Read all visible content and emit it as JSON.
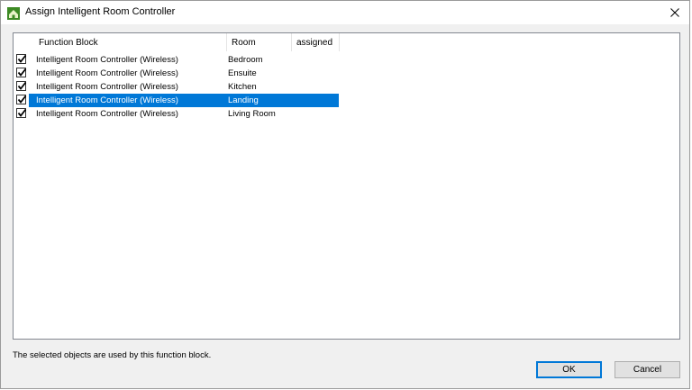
{
  "window": {
    "title": "Assign Intelligent Room Controller",
    "icon": "app-logo-icon"
  },
  "table": {
    "columns": [
      "Function Block",
      "Room",
      "assigned"
    ],
    "rows": [
      {
        "checked": true,
        "function_block": "Intelligent Room Controller (Wireless)",
        "room": "Bedroom",
        "assigned": "",
        "selected": false
      },
      {
        "checked": true,
        "function_block": "Intelligent Room Controller (Wireless)",
        "room": "Ensuite",
        "assigned": "",
        "selected": false
      },
      {
        "checked": true,
        "function_block": "Intelligent Room Controller (Wireless)",
        "room": "Kitchen",
        "assigned": "",
        "selected": false
      },
      {
        "checked": true,
        "function_block": "Intelligent Room Controller (Wireless)",
        "room": "Landing",
        "assigned": "",
        "selected": true
      },
      {
        "checked": true,
        "function_block": "Intelligent Room Controller (Wireless)",
        "room": "Living Room",
        "assigned": "",
        "selected": false
      }
    ]
  },
  "status_text": "The selected objects are used by this function block.",
  "buttons": {
    "ok": "OK",
    "cancel": "Cancel"
  },
  "colors": {
    "selection": "#0078d7",
    "icon_green": "#4a9a2a"
  }
}
